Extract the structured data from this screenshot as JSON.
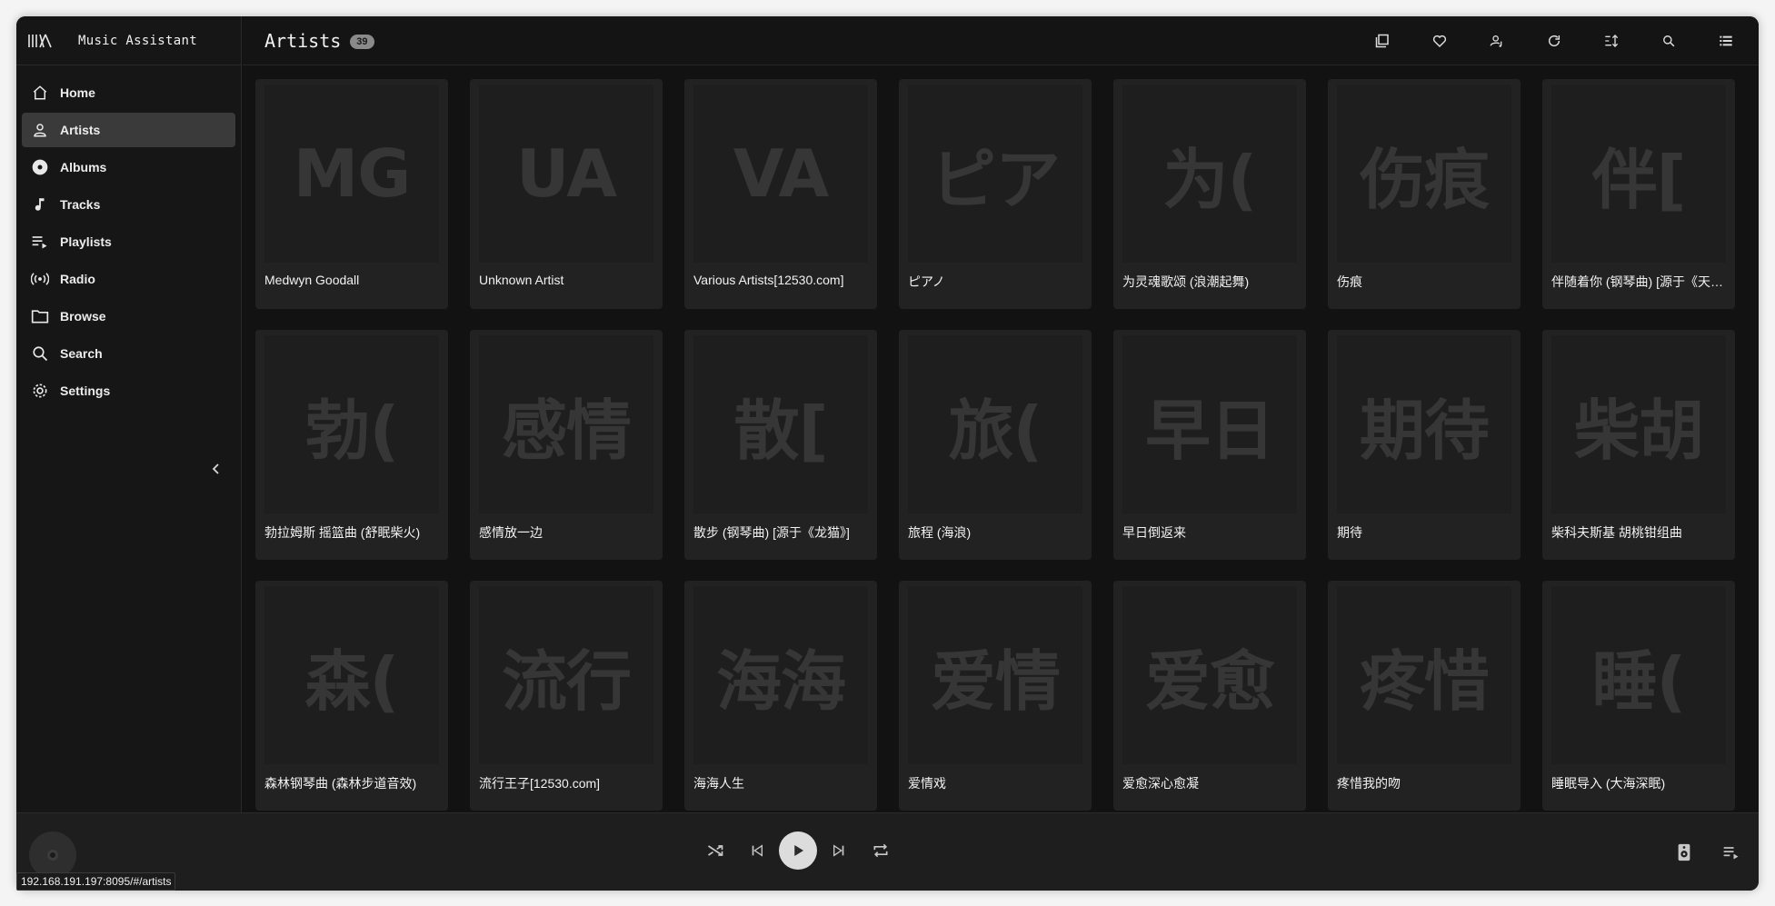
{
  "app": {
    "title": "Music Assistant"
  },
  "sidebar": {
    "items": [
      {
        "label": "Home",
        "icon": "home-icon"
      },
      {
        "label": "Artists",
        "icon": "person-icon",
        "active": true
      },
      {
        "label": "Albums",
        "icon": "album-icon"
      },
      {
        "label": "Tracks",
        "icon": "music-note-icon"
      },
      {
        "label": "Playlists",
        "icon": "playlist-icon"
      },
      {
        "label": "Radio",
        "icon": "radio-icon"
      },
      {
        "label": "Browse",
        "icon": "folder-icon"
      },
      {
        "label": "Search",
        "icon": "search-icon"
      },
      {
        "label": "Settings",
        "icon": "gear-icon"
      }
    ]
  },
  "header": {
    "title": "Artists",
    "count": "39",
    "toolbar": [
      "select-icon",
      "favorite-icon",
      "library-artist-icon",
      "refresh-icon",
      "sort-icon",
      "search-icon",
      "view-list-icon"
    ]
  },
  "artists": [
    {
      "thumb": "MG",
      "name": "Medwyn Goodall"
    },
    {
      "thumb": "UA",
      "name": "Unknown Artist"
    },
    {
      "thumb": "VA",
      "name": "Various Artists[12530.com]"
    },
    {
      "thumb": "ピア",
      "name": "ピアノ"
    },
    {
      "thumb": "为(",
      "name": "为灵魂歌颂 (浪潮起舞)"
    },
    {
      "thumb": "伤痕",
      "name": "伤痕"
    },
    {
      "thumb": "伴[",
      "name": "伴随着你 (钢琴曲) [源于《天…"
    },
    {
      "thumb": "勃(",
      "name": "勃拉姆斯 摇篮曲 (舒眠柴火)"
    },
    {
      "thumb": "感情",
      "name": "感情放一边"
    },
    {
      "thumb": "散[",
      "name": "散步 (钢琴曲) [源于《龙猫》]"
    },
    {
      "thumb": "旅(",
      "name": "旅程 (海浪)"
    },
    {
      "thumb": "早日",
      "name": "早日倒返来"
    },
    {
      "thumb": "期待",
      "name": "期待"
    },
    {
      "thumb": "柴胡",
      "name": "柴科夫斯基 胡桃钳组曲"
    },
    {
      "thumb": "森(",
      "name": "森林钢琴曲 (森林步道音效)"
    },
    {
      "thumb": "流行",
      "name": "流行王子[12530.com]"
    },
    {
      "thumb": "海海",
      "name": "海海人生"
    },
    {
      "thumb": "爱情",
      "name": "爱情戏"
    },
    {
      "thumb": "爱愈",
      "name": "爱愈深心愈凝"
    },
    {
      "thumb": "疼惜",
      "name": "疼惜我的吻"
    },
    {
      "thumb": "睡(",
      "name": "睡眠导入 (大海深眠)"
    }
  ],
  "status_bar": {
    "url": "192.168.191.197:8095/#/artists"
  }
}
